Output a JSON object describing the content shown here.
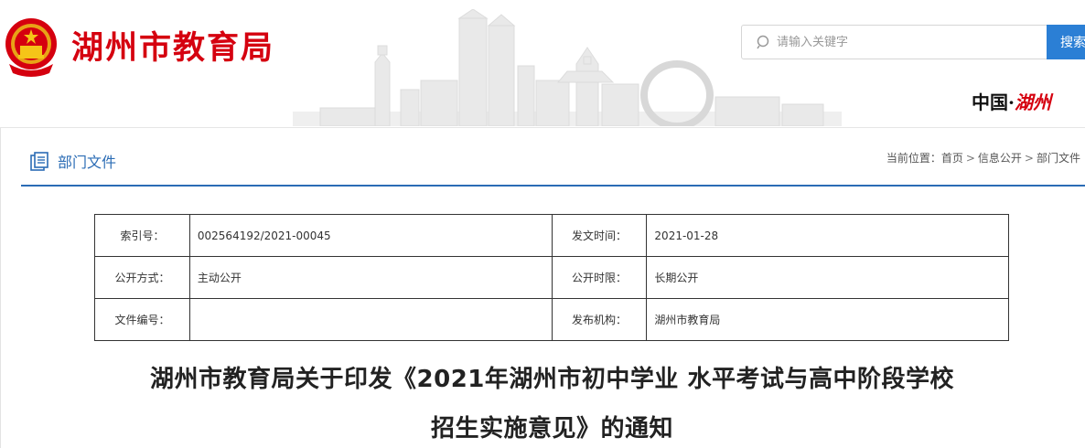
{
  "header": {
    "site_title": "湖州市教育局",
    "search_placeholder": "请输入关键字",
    "search_button": "搜索",
    "logo_text_a": "中国·",
    "logo_text_b": "湖州"
  },
  "section": {
    "title": "部门文件",
    "breadcrumb_prefix": "当前位置：",
    "breadcrumb": [
      "首页",
      "信息公开",
      "部门文件"
    ]
  },
  "meta": {
    "rows": [
      {
        "label1": "索引号：",
        "value1": "002564192/2021-00045",
        "label2": "发文时间：",
        "value2": "2021-01-28"
      },
      {
        "label1": "公开方式：",
        "value1": "主动公开",
        "label2": "公开时限：",
        "value2": "长期公开"
      },
      {
        "label1": "文件编号：",
        "value1": "",
        "label2": "发布机构：",
        "value2": "湖州市教育局"
      }
    ]
  },
  "article": {
    "title_line1": "湖州市教育局关于印发《2021年湖州市初中学业 水平考试与高中阶段学校",
    "title_line2": "招生实施意见》的通知"
  },
  "colors": {
    "brand_red": "#d5000f",
    "accent_blue": "#2b6cb5",
    "search_button_blue": "#2b7fd5"
  }
}
